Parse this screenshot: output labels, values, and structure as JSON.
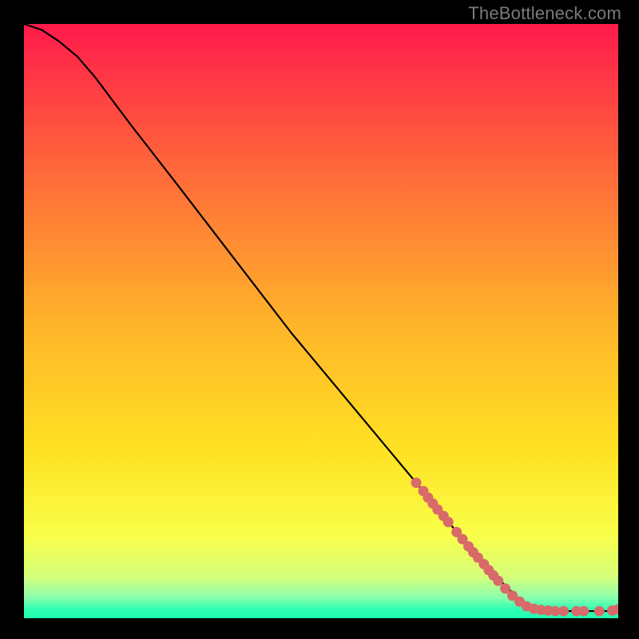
{
  "watermark": "TheBottleneck.com",
  "chart_data": {
    "type": "line",
    "title": "",
    "xlabel": "",
    "ylabel": "",
    "xlim": [
      0,
      100
    ],
    "ylim": [
      0,
      100
    ],
    "grid": false,
    "legend": false,
    "background_gradient_stops": [
      {
        "offset": 0.0,
        "color": "#ff1a4b"
      },
      {
        "offset": 0.25,
        "color": "#ff6a3a"
      },
      {
        "offset": 0.5,
        "color": "#ffb32a"
      },
      {
        "offset": 0.72,
        "color": "#ffe223"
      },
      {
        "offset": 0.86,
        "color": "#f9ff4a"
      },
      {
        "offset": 0.93,
        "color": "#d6ff7a"
      },
      {
        "offset": 0.965,
        "color": "#8bffad"
      },
      {
        "offset": 0.985,
        "color": "#2fffb3"
      },
      {
        "offset": 1.0,
        "color": "#1fffb0"
      }
    ],
    "series": [
      {
        "name": "curve",
        "stroke": "#000000",
        "values": [
          {
            "x": 0,
            "y": 100
          },
          {
            "x": 3,
            "y": 99
          },
          {
            "x": 6,
            "y": 97
          },
          {
            "x": 9,
            "y": 94.5
          },
          {
            "x": 12,
            "y": 91
          },
          {
            "x": 18,
            "y": 83
          },
          {
            "x": 25,
            "y": 74
          },
          {
            "x": 35,
            "y": 61
          },
          {
            "x": 45,
            "y": 48
          },
          {
            "x": 55,
            "y": 36
          },
          {
            "x": 65,
            "y": 24
          },
          {
            "x": 72,
            "y": 15.5
          },
          {
            "x": 78,
            "y": 8.5
          },
          {
            "x": 83,
            "y": 3.5
          },
          {
            "x": 86,
            "y": 1.6
          },
          {
            "x": 88,
            "y": 1.2
          },
          {
            "x": 92,
            "y": 1.2
          },
          {
            "x": 96,
            "y": 1.2
          },
          {
            "x": 100,
            "y": 1.2
          }
        ]
      }
    ],
    "marker_clusters": [
      {
        "name": "dots",
        "color": "#d86a6a",
        "radius": 6.5,
        "points": [
          {
            "x": 66.0,
            "y": 22.8
          },
          {
            "x": 67.2,
            "y": 21.4
          },
          {
            "x": 68.0,
            "y": 20.3
          },
          {
            "x": 68.8,
            "y": 19.3
          },
          {
            "x": 69.6,
            "y": 18.3
          },
          {
            "x": 70.6,
            "y": 17.2
          },
          {
            "x": 71.4,
            "y": 16.2
          },
          {
            "x": 72.8,
            "y": 14.5
          },
          {
            "x": 73.8,
            "y": 13.3
          },
          {
            "x": 74.8,
            "y": 12.1
          },
          {
            "x": 75.6,
            "y": 11.1
          },
          {
            "x": 76.4,
            "y": 10.2
          },
          {
            "x": 77.4,
            "y": 9.1
          },
          {
            "x": 78.2,
            "y": 8.1
          },
          {
            "x": 79.0,
            "y": 7.2
          },
          {
            "x": 79.8,
            "y": 6.3
          },
          {
            "x": 81.0,
            "y": 5.0
          },
          {
            "x": 82.2,
            "y": 3.8
          },
          {
            "x": 83.4,
            "y": 2.8
          },
          {
            "x": 84.6,
            "y": 2.0
          },
          {
            "x": 85.8,
            "y": 1.6
          },
          {
            "x": 87.0,
            "y": 1.4
          },
          {
            "x": 88.2,
            "y": 1.3
          },
          {
            "x": 89.4,
            "y": 1.2
          },
          {
            "x": 90.8,
            "y": 1.2
          },
          {
            "x": 93.0,
            "y": 1.2
          },
          {
            "x": 94.2,
            "y": 1.2
          },
          {
            "x": 96.8,
            "y": 1.2
          },
          {
            "x": 99.0,
            "y": 1.3
          },
          {
            "x": 100.0,
            "y": 1.5
          }
        ]
      }
    ]
  }
}
